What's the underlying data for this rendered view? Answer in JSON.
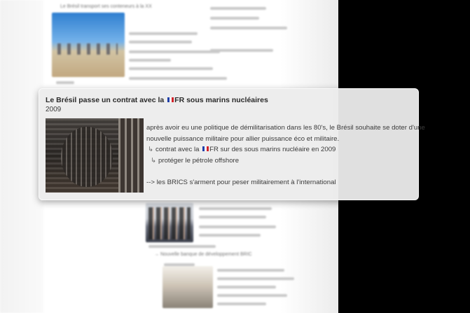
{
  "card": {
    "title_prefix": "Le Brésil passe un contrat avec la",
    "title_suffix": "FR sous marins nucléaires",
    "year": "2009",
    "lines": {
      "intro_1": "après avoir eu une politique de démilitarisation dans les 80's, le Brésil souhaite se doter d'une",
      "intro_2": "nouvelle puissance militaire pour allier puissance éco et militaire.",
      "bullet_1_prefix": "contrat avec la",
      "bullet_1_suffix": "FR sur des sous marins nucléaire en 2009",
      "bullet_2": "protéger le pétrole offshore",
      "conclusion": "--> les BRICS s'arment pour peser militairement à l'international"
    },
    "arrow_glyph": "↳"
  },
  "background": {
    "heading_top": "Le Brésil transport ses conteneurs à la XX",
    "heading_mid": "→ Nouvelle banque de développement BRIC"
  },
  "colors": {
    "flag_blue": "#1f3fa8",
    "flag_white": "#ffffff",
    "flag_red": "#d2232a"
  }
}
